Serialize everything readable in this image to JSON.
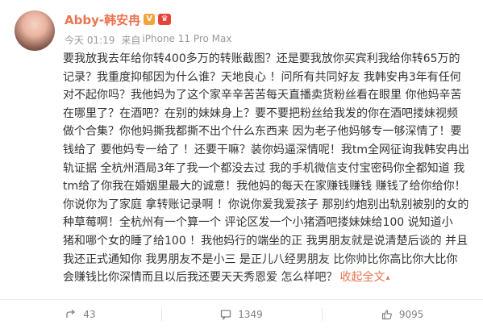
{
  "user": {
    "name": "Abby-韩安冉",
    "verified_badge": "V",
    "member_badge": "♛"
  },
  "meta": {
    "time": "今天 01:19",
    "source_prefix": "来自",
    "device": "iPhone 11 Pro Max"
  },
  "post": {
    "lines": [
      "要我放我去年给你转400多万的转账截图？还是要我放你买宾利我给你转65万的",
      "记录？我重度抑郁因为什么谁？天地良心 ！问所有共同好友 我韩安冉3年有任何",
      "对不起你吗？我他妈为了这个家辛辛苦苦每天直播卖货粉丝看在眼里 你他妈辛苦",
      "在哪里了？在酒吧？在别的妹妹身上？要不要把粉丝给我发的你在酒吧搂妹视频",
      "做个合集？你他妈撕我都撕不出个什么东西来 因为老子他妈够专一够深情了！要",
      "钱给了 要他妈专一给了 ！还要干嘛？装你妈逼深情呢！我tm全网征询我韩安冉出",
      "轨证据 全杭州酒局3年了我一个都没去过 我的手机微信支付宝密码你全都知道 我",
      "tm给了你我在婚姻里最大的诚意！我他妈的每天在家赚钱赚钱 赚钱了给你给你！",
      "你说你为了家庭 拿转账记录啊 ！你说你爱我爱孩子 那别约炮别出轨别被别的女的",
      "种草莓啊！全杭州有一个算一个 评论区发一个小猪酒吧搂妹妹给100 说知道小",
      "猪和哪个女的睡了给100 ！我他妈行的端坐的正 我男朋友就是说清楚后谈的 并且",
      "我还正式通知你 我男朋友不是小三 是正儿八经男朋友 比你帅比你高比你大比你"
    ],
    "last_line": "会赚钱比你深情而且以后我还要天天秀恩爱 怎么样吧？",
    "collapse_label": "收起全文",
    "collapse_caret": "▴"
  },
  "actions": {
    "forward_count": "43",
    "comment_count": "1349",
    "like_count": "9095"
  },
  "colors": {
    "accent": "#eb7350",
    "text": "#333333",
    "meta": "#999999"
  }
}
